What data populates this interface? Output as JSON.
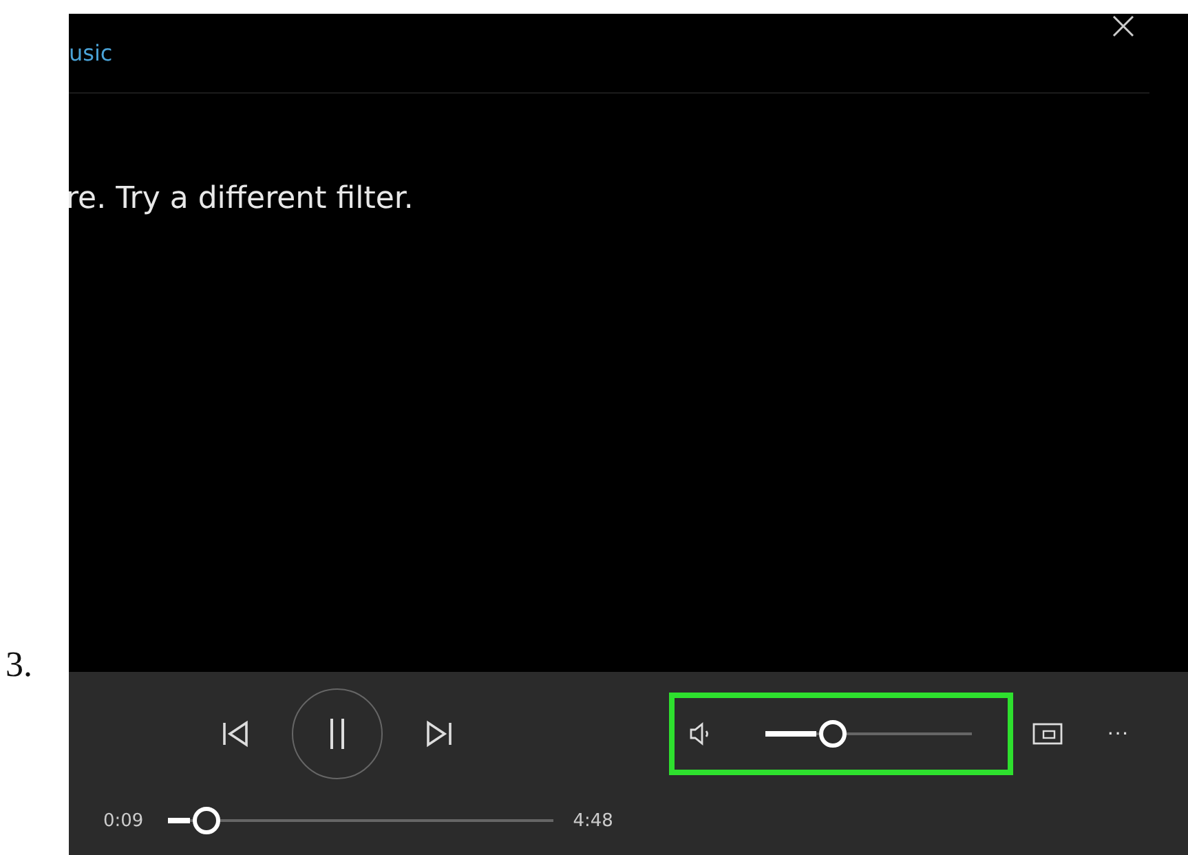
{
  "step_number": "3.",
  "header": {
    "link": "usic"
  },
  "message": "re. Try a different filter.",
  "player": {
    "playing": true,
    "current_time": "0:09",
    "total_time": "4:48",
    "seek": {
      "level": 0.07
    },
    "volume": {
      "level": 0.3,
      "highlighted": true
    },
    "more": "···"
  }
}
